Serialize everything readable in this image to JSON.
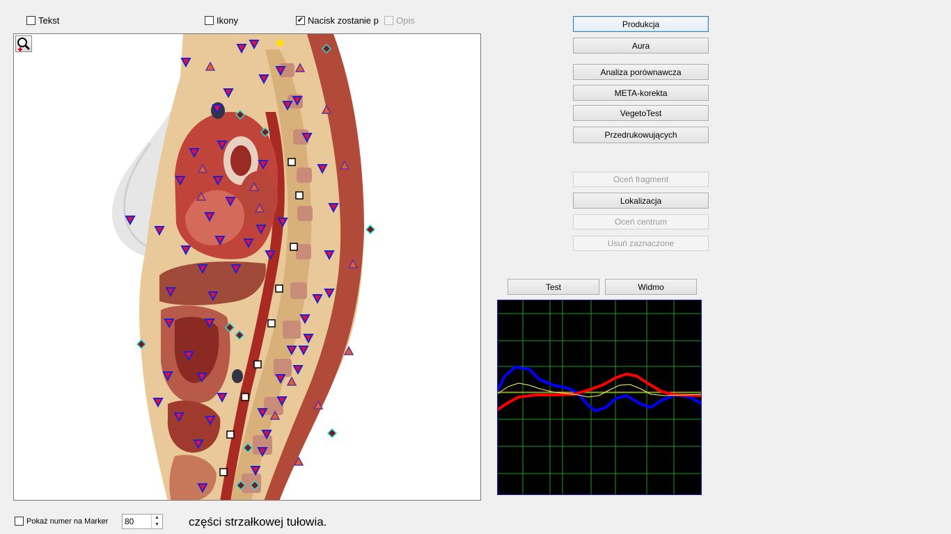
{
  "toolbar": {
    "checkboxes": [
      {
        "label": "Tekst",
        "checked": false,
        "enabled": true
      },
      {
        "label": "Ikony",
        "checked": false,
        "enabled": true
      },
      {
        "label": "Nacisk zostanie p",
        "checked": true,
        "enabled": true
      },
      {
        "label": "Opis",
        "checked": false,
        "enabled": false
      }
    ]
  },
  "actions": {
    "produkcja": "Produkcja",
    "aura": "Aura",
    "analiza": "Analiza porównawcza",
    "meta": "META-korekta",
    "vegeto": "VegetoTest",
    "przedruk": "Przedrukowujących",
    "ocen_fragment": "Oceń fragment",
    "lokalizacja": "Lokalizacja",
    "ocen_centrum": "Oceń centrum",
    "usun": "Usuń zaznaczone"
  },
  "graph_controls": {
    "test": "Test",
    "widmo": "Widmo"
  },
  "graph": {
    "background": "#000000",
    "grid_color": "#1f9a1f",
    "series": [
      {
        "color": "#0000ff",
        "points": [
          [
            0,
            560
          ],
          [
            10,
            540
          ],
          [
            25,
            527
          ],
          [
            45,
            530
          ],
          [
            60,
            545
          ],
          [
            80,
            553
          ],
          [
            100,
            557
          ],
          [
            115,
            564
          ],
          [
            128,
            580
          ],
          [
            140,
            590
          ],
          [
            155,
            585
          ],
          [
            170,
            572
          ],
          [
            185,
            568
          ],
          [
            205,
            580
          ],
          [
            220,
            585
          ],
          [
            235,
            575
          ],
          [
            255,
            567
          ],
          [
            275,
            570
          ],
          [
            294,
            580
          ]
        ]
      },
      {
        "color": "#ff0000",
        "points": [
          [
            0,
            588
          ],
          [
            15,
            578
          ],
          [
            30,
            570
          ],
          [
            55,
            567
          ],
          [
            80,
            567
          ],
          [
            110,
            566
          ],
          [
            130,
            560
          ],
          [
            150,
            553
          ],
          [
            170,
            542
          ],
          [
            185,
            537
          ],
          [
            200,
            540
          ],
          [
            215,
            550
          ],
          [
            235,
            562
          ],
          [
            255,
            567
          ],
          [
            294,
            568
          ]
        ]
      },
      {
        "color": "#ffff66",
        "points": [
          [
            0,
            565
          ],
          [
            15,
            555
          ],
          [
            30,
            550
          ],
          [
            45,
            553
          ],
          [
            60,
            558
          ],
          [
            80,
            563
          ],
          [
            100,
            565
          ],
          [
            115,
            567
          ],
          [
            130,
            570
          ],
          [
            145,
            568
          ],
          [
            160,
            560
          ],
          [
            175,
            553
          ],
          [
            190,
            552
          ],
          [
            205,
            558
          ],
          [
            220,
            566
          ],
          [
            240,
            568
          ],
          [
            294,
            566
          ]
        ]
      }
    ]
  },
  "markers": {
    "triangles_down": [
      [
        266,
        88
      ],
      [
        346,
        68
      ],
      [
        364,
        62
      ],
      [
        378,
        112
      ],
      [
        402,
        100
      ],
      [
        327,
        132
      ],
      [
        311,
        155
      ],
      [
        412,
        150
      ],
      [
        426,
        143
      ],
      [
        440,
        196
      ],
      [
        318,
        207
      ],
      [
        278,
        218
      ],
      [
        377,
        235
      ],
      [
        462,
        241
      ],
      [
        258,
        258
      ],
      [
        312,
        258
      ],
      [
        330,
        288
      ],
      [
        478,
        297
      ],
      [
        186,
        315
      ],
      [
        228,
        330
      ],
      [
        300,
        310
      ],
      [
        374,
        328
      ],
      [
        405,
        318
      ],
      [
        315,
        344
      ],
      [
        356,
        348
      ],
      [
        266,
        358
      ],
      [
        387,
        365
      ],
      [
        472,
        365
      ],
      [
        290,
        385
      ],
      [
        338,
        385
      ],
      [
        244,
        418
      ],
      [
        305,
        424
      ],
      [
        455,
        428
      ],
      [
        472,
        420
      ],
      [
        242,
        463
      ],
      [
        300,
        463
      ],
      [
        437,
        457
      ],
      [
        442,
        485
      ],
      [
        418,
        502
      ],
      [
        435,
        502
      ],
      [
        270,
        510
      ],
      [
        427,
        530
      ],
      [
        240,
        539
      ],
      [
        289,
        541
      ],
      [
        402,
        543
      ],
      [
        226,
        577
      ],
      [
        318,
        570
      ],
      [
        404,
        575
      ],
      [
        256,
        598
      ],
      [
        301,
        603
      ],
      [
        376,
        592
      ],
      [
        382,
        623
      ],
      [
        284,
        637
      ],
      [
        376,
        648
      ],
      [
        366,
        675
      ],
      [
        290,
        700
      ]
    ],
    "triangles_up": [
      [
        301,
        95
      ],
      [
        430,
        97
      ],
      [
        468,
        157
      ],
      [
        494,
        237
      ],
      [
        290,
        242
      ],
      [
        364,
        268
      ],
      [
        288,
        282
      ],
      [
        372,
        299
      ],
      [
        506,
        379
      ],
      [
        418,
        548
      ],
      [
        500,
        504
      ],
      [
        394,
        597
      ],
      [
        456,
        582
      ],
      [
        428,
        663
      ]
    ],
    "diamonds": [
      [
        468,
        69
      ],
      [
        344,
        164
      ],
      [
        380,
        189
      ],
      [
        531,
        329
      ],
      [
        202,
        494
      ],
      [
        329,
        470
      ],
      [
        343,
        481
      ],
      [
        476,
        622
      ],
      [
        355,
        643
      ],
      [
        345,
        697
      ],
      [
        365,
        697
      ]
    ],
    "squares": [
      [
        418,
        232
      ],
      [
        429,
        280
      ],
      [
        421,
        354
      ],
      [
        400,
        414
      ],
      [
        389,
        464
      ],
      [
        369,
        523
      ],
      [
        351,
        570
      ],
      [
        330,
        624
      ],
      [
        320,
        678
      ]
    ],
    "yellow_dot": [
      401,
      61
    ]
  },
  "footer": {
    "show_number_label": "Pokaż numer na Marker",
    "show_number_checked": false,
    "spin_value": "80",
    "caption": "części strzałkowej tułowia."
  }
}
